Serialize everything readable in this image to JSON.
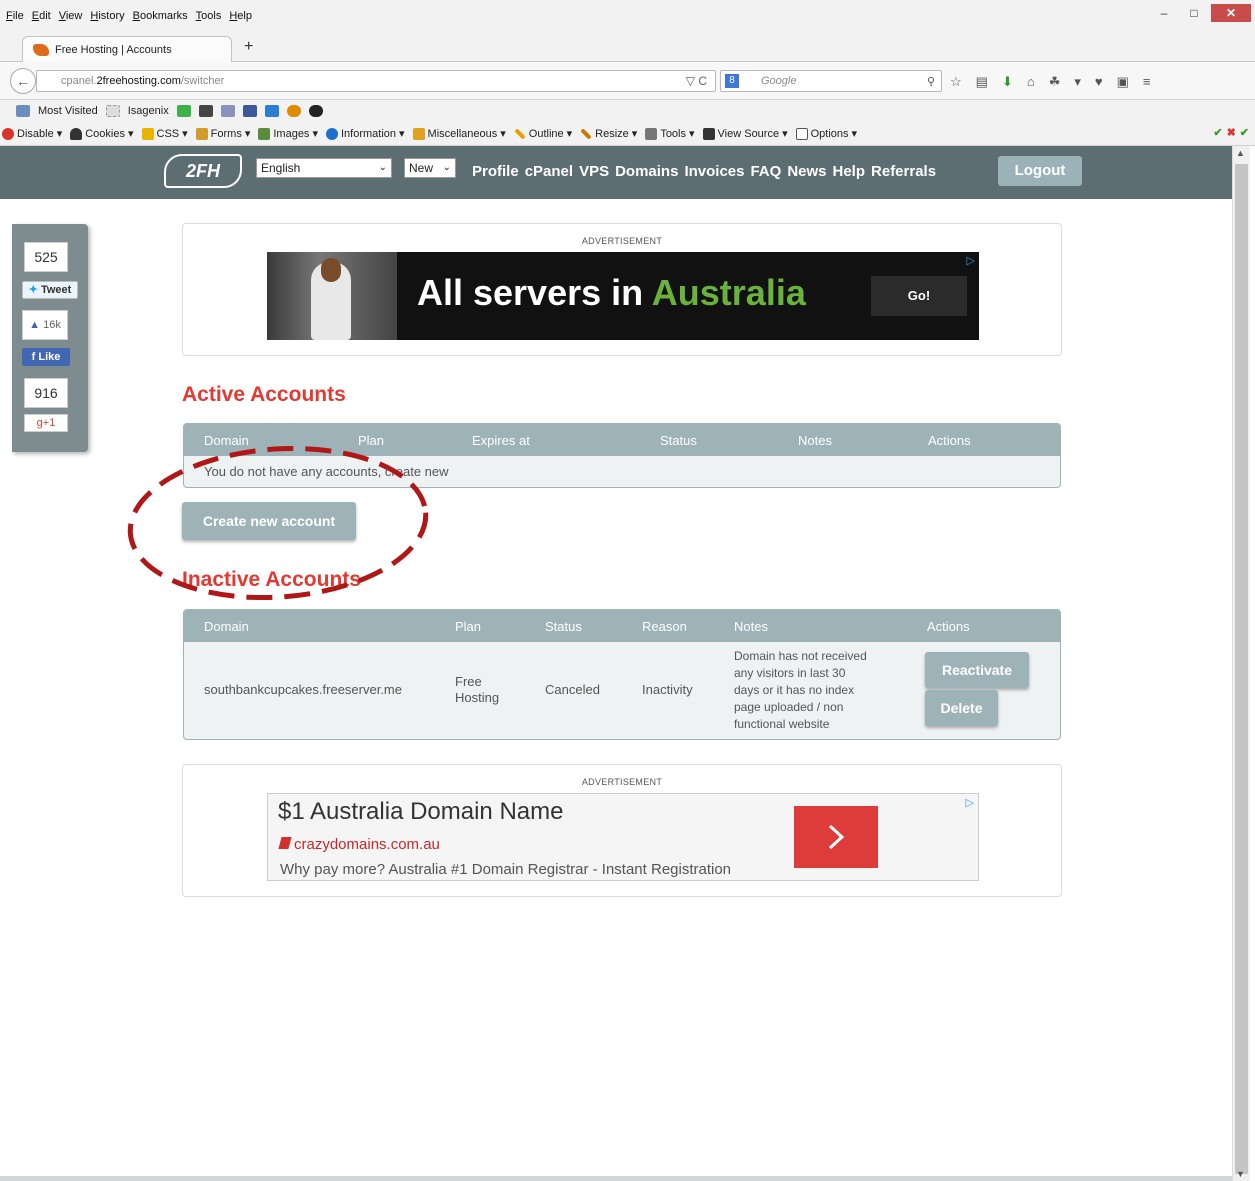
{
  "browser": {
    "menu": [
      "File",
      "Edit",
      "View",
      "History",
      "Bookmarks",
      "Tools",
      "Help"
    ],
    "tab_title": "Free Hosting | Accounts",
    "url_prefix": "cpanel.",
    "url_host": "2freehosting.com",
    "url_path": "/switcher",
    "search_placeholder": "Google",
    "bookmarks": [
      "Most Visited",
      "Isagenix"
    ],
    "devbar": [
      "Disable",
      "Cookies",
      "CSS",
      "Forms",
      "Images",
      "Information",
      "Miscellaneous",
      "Outline",
      "Resize",
      "Tools",
      "View Source",
      "Options"
    ]
  },
  "site": {
    "logo": "2FH",
    "language": "English",
    "new_select": "New",
    "nav": [
      "Profile",
      "cPanel",
      "VPS",
      "Domains",
      "Invoices",
      "FAQ",
      "News",
      "Help",
      "Referrals"
    ],
    "logout": "Logout"
  },
  "social": {
    "tweet_count": "525",
    "tweet": "Tweet",
    "like_count": "16k",
    "like": "Like",
    "plus_count": "916",
    "plus": "+1"
  },
  "ad_top": {
    "label": "ADVERTISEMENT",
    "headline_a": "All servers in ",
    "headline_b": "Australia",
    "cta": "Go!"
  },
  "active": {
    "title": "Active Accounts",
    "columns": [
      "Domain",
      "Plan",
      "Expires at",
      "Status",
      "Notes",
      "Actions"
    ],
    "empty_text": "You do not have any accounts, create new",
    "create_button": "Create new account"
  },
  "inactive": {
    "title": "Inactive Accounts",
    "columns": [
      "Domain",
      "Plan",
      "Status",
      "Reason",
      "Notes",
      "Actions"
    ],
    "rows": [
      {
        "domain": "southbankcupcakes.freeserver.me",
        "plan_line1": "Free",
        "plan_line2": "Hosting",
        "status": "Canceled",
        "reason": "Inactivity",
        "notes_lines": [
          "Domain has not received",
          "any visitors in last 30",
          "days or it has no index",
          "page uploaded / non",
          "functional website"
        ],
        "reactivate": "Reactivate",
        "delete": "Delete"
      }
    ]
  },
  "ad_bottom": {
    "label": "ADVERTISEMENT",
    "title": "$1 Australia Domain Name",
    "url": "crazydomains.com.au",
    "desc": "Why pay more? Australia #1 Domain Registrar - Instant Registration"
  },
  "colors": {
    "header": "#5d6e73",
    "accent_red": "#e23a32",
    "button": "#9eb3b8"
  }
}
